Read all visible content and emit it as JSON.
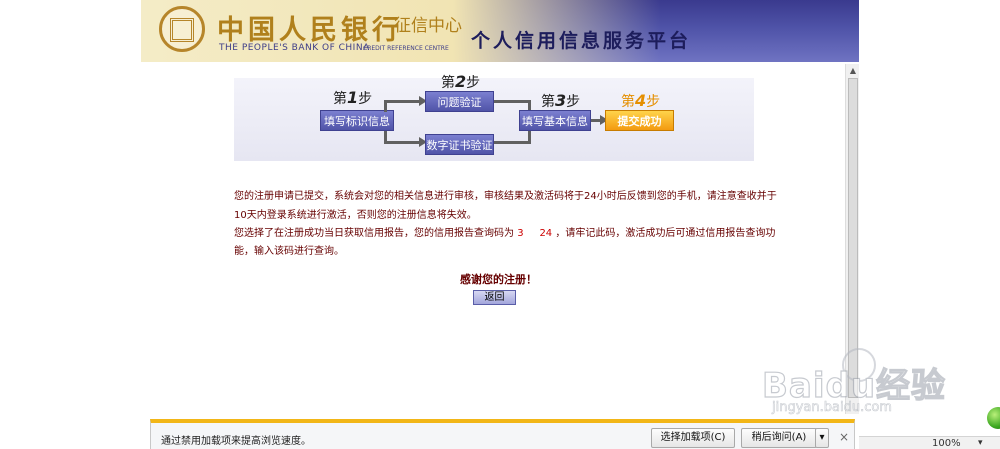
{
  "header": {
    "bank_name_cn": "中国人民银行",
    "bank_subtitle": "征信中心",
    "bank_name_en": "THE PEOPLE'S BANK OF CHINA",
    "credit_ref": "CREDIT REFERENCE CENTRE",
    "platform_title": "个人信用信息服务平台",
    "accent_color": "#4f53a8"
  },
  "steps": {
    "step1_label": "第",
    "step1_num": "1",
    "step1_suffix": "步",
    "step1_box": "填写标识信息",
    "step2_label": "第",
    "step2_num": "2",
    "step2_suffix": "步",
    "step2_box_top": "问题验证",
    "step2_box_bottom": "数字证书验证",
    "step3_label": "第",
    "step3_num": "3",
    "step3_suffix": "步",
    "step3_box": "填写基本信息",
    "step4_label": "第",
    "step4_num": "4",
    "step4_suffix": "步",
    "step4_box": "提交成功"
  },
  "message": {
    "line1": "您的注册申请已提交，系统会对您的相关信息进行审核，审核结果及激活码将于24小时后反馈到您的手机，请注意查收并于",
    "line2": "10天内登录系统进行激活，否则您的注册信息将失效。",
    "line3_prefix": "您选择了在注册成功当日获取信用报告，您的信用报告查询码为",
    "line3_code": "3     24",
    "line3_suffix": "，请牢记此码，激活成功后可通过信用报告查询功",
    "line4": "能，输入该码进行查询。",
    "thanks": "感谢您的注册！",
    "back_button": "返回"
  },
  "notification": {
    "text": "通过禁用加载项来提高浏览速度。",
    "choose_addons": "选择加载项(C)",
    "ask_later": "稍后询问(A)",
    "dropdown": "▾",
    "close": "×"
  },
  "status": {
    "zoom": "100%",
    "zoom_chevron": "▾"
  },
  "watermark": {
    "brand": "Baidu经验",
    "url": "jingyan.baidu.com"
  }
}
